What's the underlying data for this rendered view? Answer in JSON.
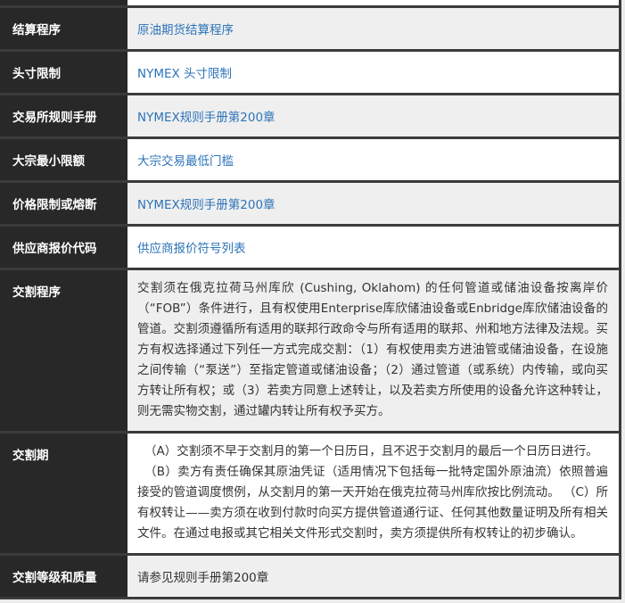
{
  "colors": {
    "label_column_bg": "#282828",
    "row_alt_bg": "#efefef",
    "border": "#3b3b3b",
    "link": "#2d74b8",
    "body_text": "#333333"
  },
  "table": {
    "rows": [
      {
        "label": "结算程序",
        "value": "原油期货结算程序",
        "type": "link"
      },
      {
        "label": "头寸限制",
        "value": "NYMEX 头寸限制",
        "type": "link"
      },
      {
        "label": "交易所规则手册",
        "value": "NYMEX规则手册第200章",
        "type": "link"
      },
      {
        "label": "大宗最小限额",
        "value": "大宗交易最低门槛",
        "type": "link"
      },
      {
        "label": "价格限制或熔断",
        "value": "NYMEX规则手册第200章",
        "type": "link"
      },
      {
        "label": "供应商报价代码",
        "value": "供应商报价符号列表",
        "type": "link"
      },
      {
        "label": "交割程序",
        "type": "text",
        "paragraphs": [
          "交割须在俄克拉荷马州库欣 (Cushing, Oklahom) 的任何管道或储油设备按离岸价（“FOB”）条件进行，且有权使用Enterprise库欣储油设备或Enbridge库欣储油设备的管道。交割须遵循所有适用的联邦行政命令与所有适用的联邦、州和地方法律及法规。买方有权选择通过下列任一方式完成交割：（1）有权使用卖方进油管或储油设备，在设施之间传输（“泵送”）至指定管道或储油设备；（2）通过管道（或系统）内传输，或向买方转让所有权；或（3）若卖方同意上述转让，以及若卖方所使用的设备允许这种转让，则无需实物交割，通过罐内转让所有权予买方。"
        ]
      },
      {
        "label": "交割期",
        "type": "text",
        "paragraphs": [
          "（A）交割须不早于交割月的第一个日历日，且不迟于交割月的最后一个日历日进行。",
          "（B）卖方有责任确保其原油凭证（适用情况下包括每一批特定国外原油流）依照普遍接受的管道调度惯例，从交割月的第一天开始在俄克拉荷马州库欣按比例流动。 （C）所有权转让——卖方须在收到付款时向买方提供管道通行证、任何其他数量证明及所有相关文件。在通过电报或其它相关文件形式交割时，卖方须提供所有权转让的初步确认。"
        ]
      },
      {
        "label": "交割等级和质量",
        "value": "请参见规则手册第200章",
        "type": "text"
      }
    ]
  }
}
